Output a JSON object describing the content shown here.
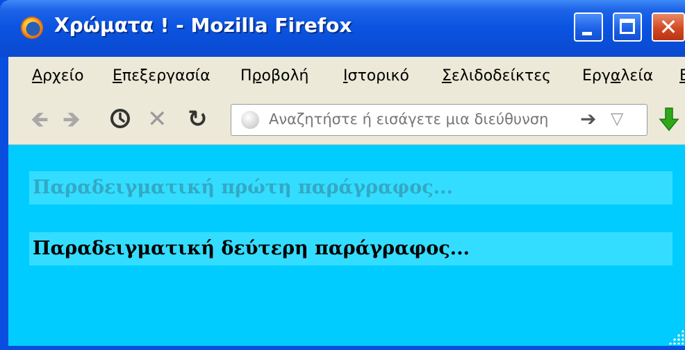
{
  "window": {
    "title": "Χρώματα ! - Mozilla Firefox"
  },
  "menubar": {
    "items": [
      {
        "label": "Αρχείο",
        "accel": "Α",
        "rest": "ρχείο"
      },
      {
        "label": "Επεξεργασία",
        "accel": "Ε",
        "rest": "πεξεργασία"
      },
      {
        "label": "Προβολή",
        "pre": "Π",
        "accel": "ρ",
        "rest": "οβολή"
      },
      {
        "label": "Ιστορικό",
        "accel": "Ι",
        "rest": "στορικό"
      },
      {
        "label": "Σελιδοδείκτες",
        "accel": "Σ",
        "rest": "ελιδοδείκτες"
      },
      {
        "label": "Εργαλεία",
        "pre": "Εργ",
        "accel": "α",
        "rest": "λεία"
      },
      {
        "label": "Β",
        "accel": "Β",
        "rest": ""
      }
    ]
  },
  "navbar": {
    "back_icon": "back-arrow-icon",
    "forward_icon": "forward-arrow-icon",
    "history_icon": "clock-icon",
    "stop_icon": "stop-x-icon",
    "reload_icon": "reload-icon",
    "url_placeholder": "Αναζητήστε ή εισάγετε μια διεύθυνση",
    "go_icon": "go-arrow-icon",
    "dropdown_icon": "dropdown-triangle-icon",
    "download_icon": "download-arrow-icon"
  },
  "content": {
    "background": "#00ccff",
    "paragraph_background": "#33ddff",
    "paragraph1": {
      "text": "Παραδειγματική πρώτη παράγραφος...",
      "color": "#33a8c4"
    },
    "paragraph2": {
      "text": "Παραδειγματική δεύτερη παράγραφος...",
      "color": "#000000"
    }
  }
}
